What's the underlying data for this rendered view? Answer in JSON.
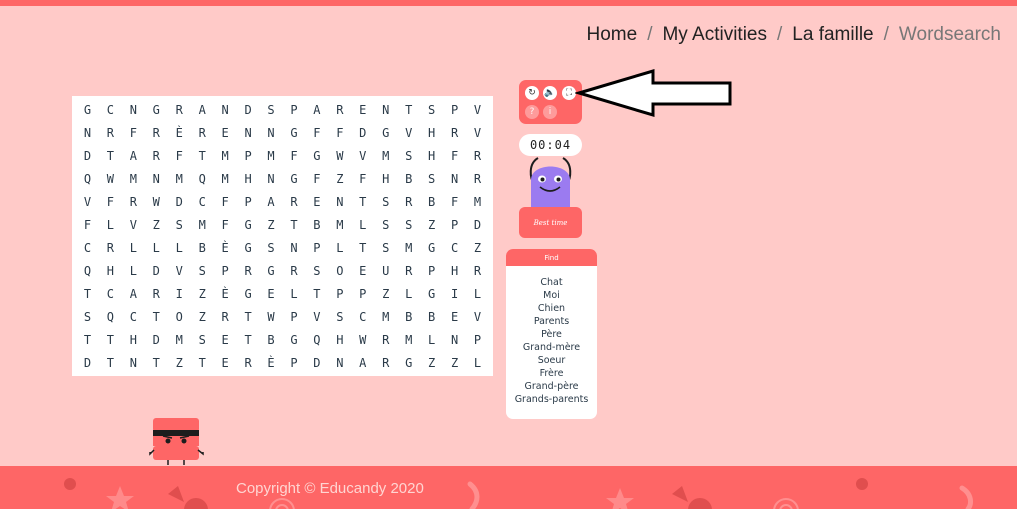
{
  "breadcrumb": {
    "items": [
      "Home",
      "My Activities",
      "La famille"
    ],
    "current": "Wordsearch",
    "separator": "/"
  },
  "grid": {
    "rows": [
      "GCNGRANDSPARENTSPV",
      "NRFRÈRENNGFFDGVHRV",
      "DTARFTMPMFGWVMSHFR",
      "QWMNMQMHNGFZFHBSNR",
      "VFRWDCFPARENTSRBFM",
      "FLVZSMFGZTBMLSSZPD",
      "CRLLLBÈGSNPLTSMGCZ",
      "QHLDVSPRGRSOEURPHR",
      "TCARIZÈGELTPPZLGIL",
      "SQCTOZRTWPVSCMBBEV",
      "TTHDMSETBGQHWRMLNP",
      "DTNTZTERÈPDNARGZZL"
    ]
  },
  "controls": {
    "restart_icon": "↻",
    "sound_icon": "🔈",
    "fullscreen_icon": "⛶",
    "help_icon": "?",
    "info_icon": "i"
  },
  "timer": {
    "value": "00:04"
  },
  "best_time": {
    "label": "Best time"
  },
  "find": {
    "header": "Find",
    "words": [
      "Chat",
      "Moi",
      "Chien",
      "Parents",
      "Père",
      "Grand-mère",
      "Soeur",
      "Frère",
      "Grand-père",
      "Grands-parents"
    ]
  },
  "footer": {
    "copyright": "Copyright © Educandy 2020"
  },
  "colors": {
    "background": "#ffcac8",
    "accent": "#fe6666",
    "monster": "#9b7bf0",
    "grid_text": "#2a3a48"
  }
}
